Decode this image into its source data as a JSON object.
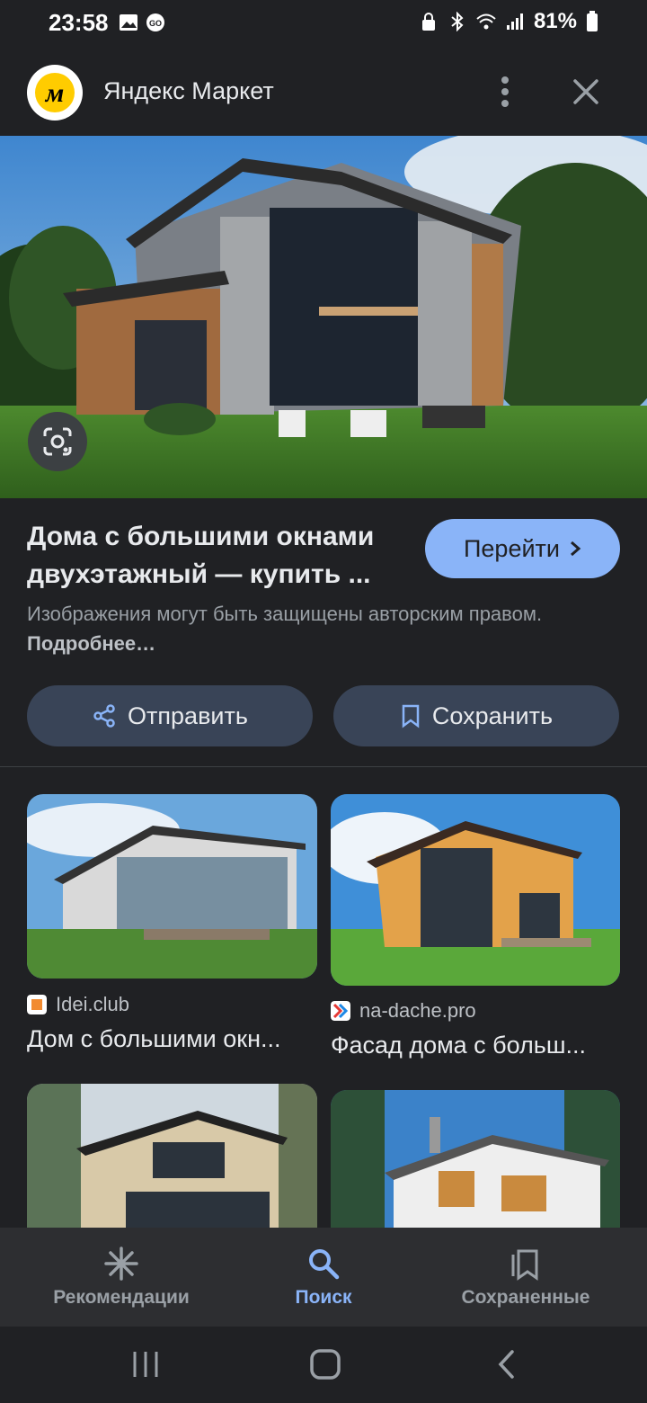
{
  "status_bar": {
    "time": "23:58",
    "battery": "81%"
  },
  "header": {
    "title": "Яндекс Маркет",
    "logo_letter": "м"
  },
  "result": {
    "title": "Дома с большими окнами двухэтажный — купить ...",
    "go_label": "Перейти",
    "copyright_text": "Изображения могут быть защищены авторским правом.",
    "more_label": "Подробнее…"
  },
  "actions": {
    "share_label": "Отправить",
    "save_label": "Сохранить"
  },
  "related": [
    {
      "source": "Idei.club",
      "title": "Дом с большими окн..."
    },
    {
      "source": "na-dache.pro",
      "title": "Фасад дома с больш..."
    }
  ],
  "bottom_nav": {
    "items": [
      {
        "label": "Рекомендации",
        "icon": "sparkle-icon"
      },
      {
        "label": "Поиск",
        "icon": "search-icon"
      },
      {
        "label": "Сохраненные",
        "icon": "saved-icon"
      }
    ],
    "active": "Поиск"
  },
  "colors": {
    "background": "#202124",
    "accent": "#8ab4f8",
    "button_bg": "#394457"
  }
}
